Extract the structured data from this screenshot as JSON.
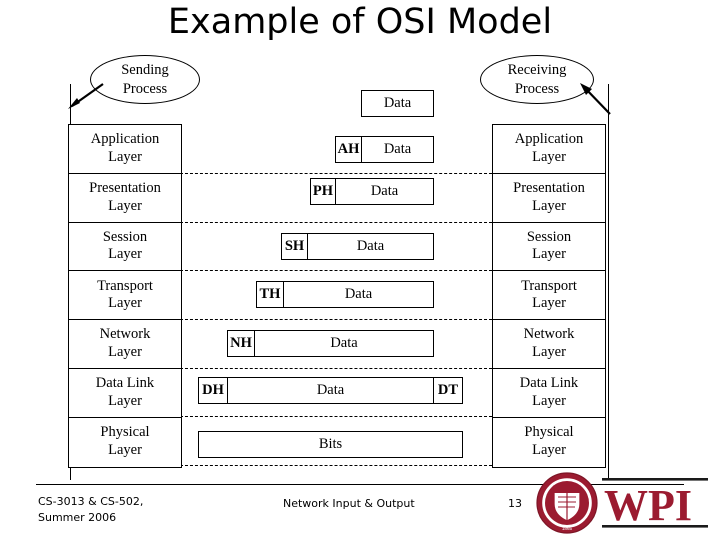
{
  "slide": {
    "title": "Example of OSI Model"
  },
  "endpoints": {
    "sending": {
      "line1": "Sending",
      "line2": "Process",
      "name": "sending-process"
    },
    "receiving": {
      "line1": "Receiving",
      "line2": "Process",
      "name": "receiving-process"
    }
  },
  "layers": [
    {
      "line1": "Application",
      "line2": "Layer"
    },
    {
      "line1": "Presentation",
      "line2": "Layer"
    },
    {
      "line1": "Session",
      "line2": "Layer"
    },
    {
      "line1": "Transport",
      "line2": "Layer"
    },
    {
      "line1": "Network",
      "line2": "Layer"
    },
    {
      "line1": "Data Link",
      "line2": "Layer"
    },
    {
      "line1": "Physical",
      "line2": "Layer"
    }
  ],
  "pdus": [
    {
      "layer": "Application",
      "header": "",
      "payload": "Data",
      "trailer": ""
    },
    {
      "layer": "Application",
      "header": "AH",
      "payload": "Data",
      "trailer": ""
    },
    {
      "layer": "Presentation",
      "header": "PH",
      "payload": "Data",
      "trailer": ""
    },
    {
      "layer": "Session",
      "header": "SH",
      "payload": "Data",
      "trailer": ""
    },
    {
      "layer": "Transport",
      "header": "TH",
      "payload": "Data",
      "trailer": ""
    },
    {
      "layer": "Network",
      "header": "NH",
      "payload": "Data",
      "trailer": ""
    },
    {
      "layer": "Data Link",
      "header": "DH",
      "payload": "Data",
      "trailer": "DT"
    },
    {
      "layer": "Physical",
      "header": "",
      "payload": "Bits",
      "trailer": ""
    }
  ],
  "footer": {
    "course_line1": "CS-3013 & CS-502,",
    "course_line2": "Summer 2006",
    "topic": "Network Input & Output",
    "page": "13",
    "logo_text": "WPI",
    "logo_color": "#9B1B30"
  }
}
